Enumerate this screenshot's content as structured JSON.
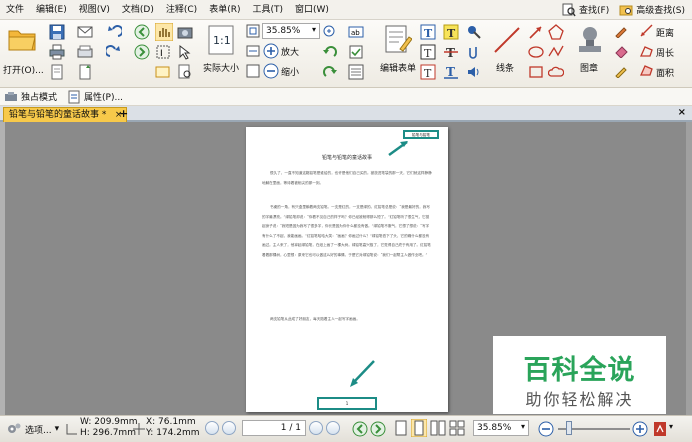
{
  "menu": {
    "items": [
      "文件",
      "编辑(E)",
      "视图(V)",
      "文档(D)",
      "注释(C)",
      "表单(R)",
      "工具(T)",
      "窗口(W)"
    ],
    "find_label": "查找(F)",
    "advanced_find_label": "高级查找(S)"
  },
  "ribbon": {
    "open_label": "打开(O)...",
    "actual_size_label": "实际大小",
    "zoom_value": "35.85%",
    "zoom_in_label": "放大",
    "zoom_out_label": "缩小",
    "edit_form_label": "编辑表单",
    "line_label": "线条",
    "stamp_label": "图章",
    "distance_label": "距离",
    "perimeter_label": "周长",
    "area_label": "面积"
  },
  "modebar": {
    "single_mode_label": "独占模式",
    "properties_label": "属性(P)..."
  },
  "tabs": {
    "active_label": "铅笔与铅笔的童话故事 *",
    "close_symbol": "×",
    "add_symbol": "+",
    "close_all_symbol": "×"
  },
  "document": {
    "header_text": "铅笔与铅笔",
    "title": "铅笔与铅笔的童话故事",
    "paragraphs": [
      "很久了，一直不知道这箱铅笔是谁给的，也许是他们自己买的。被放进笔袋的那一天，它们就这样静静地躺在里面，等待着被削尖的那一刻。",
      "书桌的一角，有只盒里躺着两支铅笔。一支是红的，一支是绿的。红铅笔总是说：“我是最好的，我写的字最漂亮。”绿铅笔却说：“你看不见自己的样子吗？你已经被削得那么短了。”红铅笔听了很生气，它挺起身子说：“我短是因为我写了很多字，你长是因为你什么都没有做。”绿铅笔不服气，它想了想说：“写字有什么了不起，我能画画。”红铅笔哈哈大笑：“画画？你画过什么？”绿铅笔低下了头，它的确什么都没有画过。主人来了，他拿起绿铅笔，在纸上画了一棵大树。绿铅笔高兴极了，它觉得自己终于有用了。红铅笔看着那棵树，心里想：原来它也可以做这么好的事情。于是它对绿铅笔说：“我们一起帮主人做作业吧。”",
      "两支铅笔从此成了好朋友，每天陪着主人一起写字画画。"
    ],
    "page_number": "1"
  },
  "watermark": {
    "main_text": "百科全说",
    "sub_text": "助你轻松解决"
  },
  "statusbar": {
    "options_label": "选项...",
    "width_label": "W: 209.9mm",
    "height_label": "H: 296.7mm",
    "x_label": "X:   76.1mm",
    "y_label": "Y: 174.2mm",
    "page_field": "1 / 1",
    "zoom_value": "35.85%"
  },
  "colors": {
    "tab_active": "#f7c94a",
    "annotation_teal": "#1c8c86",
    "watermark_green": "#2aa45a",
    "workspace_gray": "#8a8a8a"
  }
}
